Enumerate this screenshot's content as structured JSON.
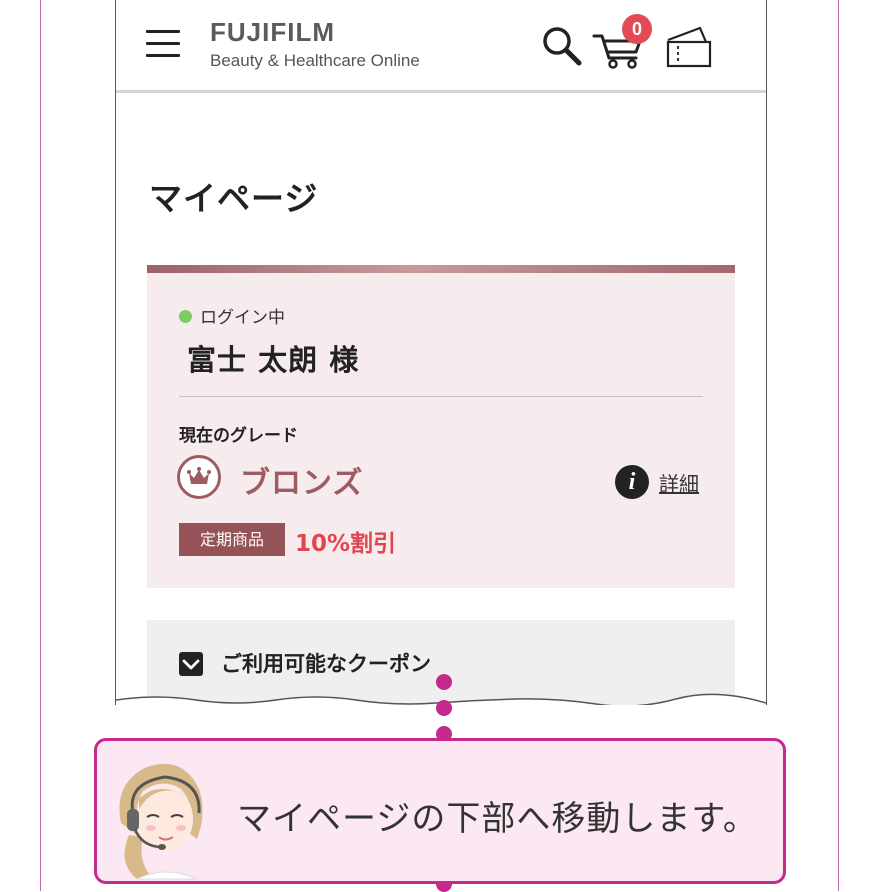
{
  "header": {
    "brand_name": "FUJIFILM",
    "brand_sub": "Beauty & Healthcare Online",
    "cart_count": "0",
    "icons": [
      "menu-icon",
      "search-icon",
      "cart-icon",
      "ticket-icon"
    ]
  },
  "page": {
    "title": "マイページ"
  },
  "member": {
    "status": "ログイン中",
    "name": "富士 太朗 様",
    "grade_label": "現在のグレード",
    "grade_name": "ブロンズ",
    "detail_label": "詳細",
    "tag_label": "定期商品",
    "discount": "10%割引"
  },
  "coupon": {
    "title": "ご利用可能なクーポン"
  },
  "tip": {
    "text": "マイページの下部へ移動します。"
  },
  "colors": {
    "accent": "#c42a8c",
    "grade": "#9d5c60",
    "discount": "#e0464f",
    "badge": "#e24b53",
    "status_dot": "#7ecb63",
    "card_bg": "#f7eced"
  }
}
